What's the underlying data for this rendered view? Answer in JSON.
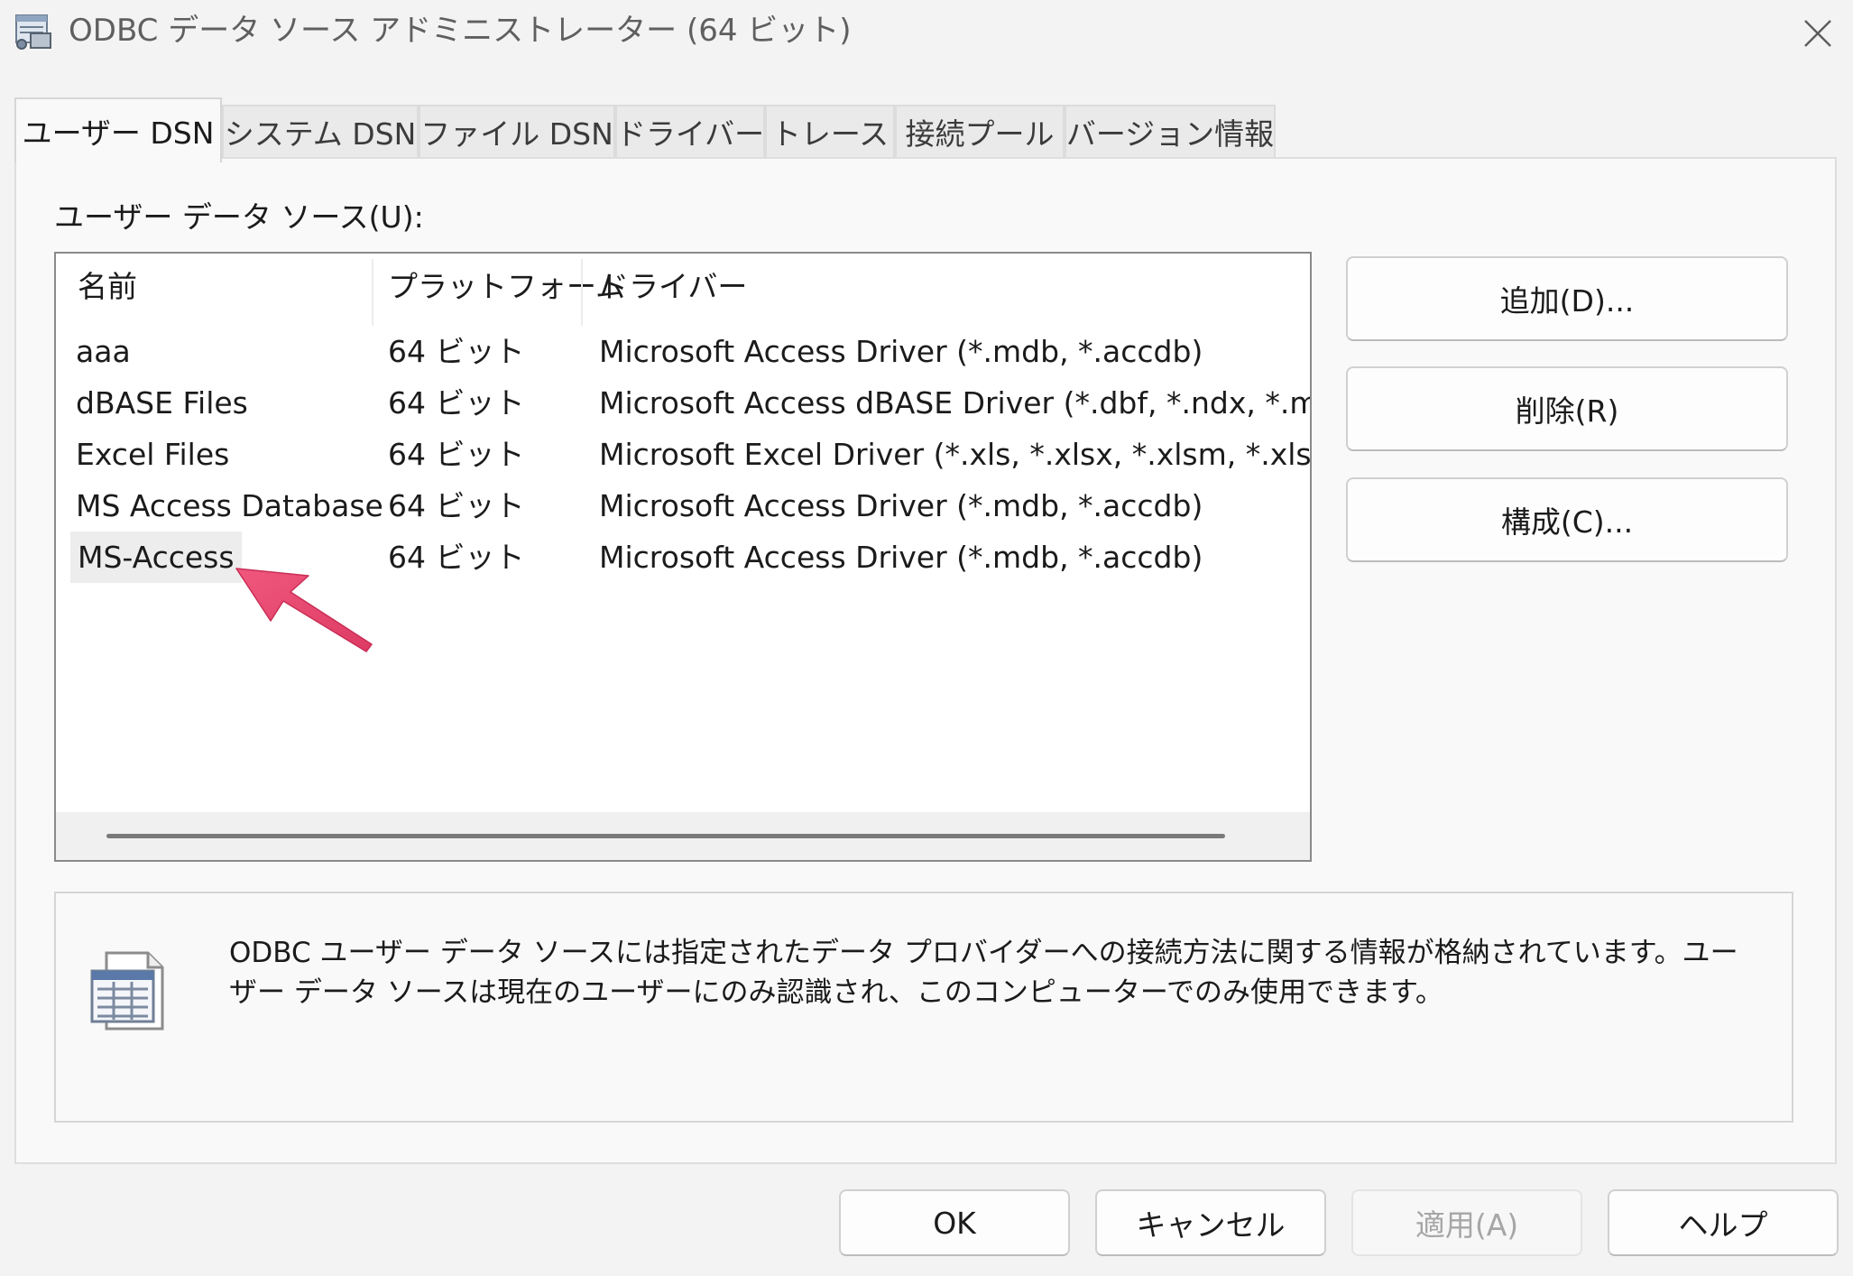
{
  "window": {
    "title": "ODBC データ ソース アドミニストレーター (64 ビット)",
    "icon": "database-admin-icon",
    "close_icon": "close-icon"
  },
  "tabs": [
    {
      "label": "ユーザー DSN",
      "active": true
    },
    {
      "label": "システム DSN",
      "active": false
    },
    {
      "label": "ファイル DSN",
      "active": false
    },
    {
      "label": "ドライバー",
      "active": false
    },
    {
      "label": "トレース",
      "active": false
    },
    {
      "label": "接続プール",
      "active": false
    },
    {
      "label": "バージョン情報",
      "active": false
    }
  ],
  "user_dsn": {
    "section_label": "ユーザー データ ソース(U):",
    "columns": [
      "名前",
      "プラットフォーム",
      "ドライバー"
    ],
    "rows": [
      {
        "name": "aaa",
        "platform": "64 ビット",
        "driver": "Microsoft Access Driver (*.mdb, *.accdb)"
      },
      {
        "name": "dBASE Files",
        "platform": "64 ビット",
        "driver": "Microsoft Access dBASE Driver (*.dbf, *.ndx, *.mdx)"
      },
      {
        "name": "Excel Files",
        "platform": "64 ビット",
        "driver": "Microsoft Excel Driver (*.xls, *.xlsx, *.xlsm, *.xlsb)"
      },
      {
        "name": "MS Access Database",
        "platform": "64 ビット",
        "driver": "Microsoft Access Driver (*.mdb, *.accdb)"
      },
      {
        "name": "MS-Access",
        "platform": "64 ビット",
        "driver": "Microsoft Access Driver (*.mdb, *.accdb)"
      }
    ],
    "selected_row": "MS-Access",
    "buttons": {
      "add": "追加(D)...",
      "remove": "削除(R)",
      "configure": "構成(C)..."
    },
    "info_text": "ODBC ユーザー データ ソースには指定されたデータ プロバイダーへの接続方法に関する情報が格納されています。ユーザー データ ソースは現在のユーザーにのみ認識され、このコンピューターでのみ使用できます。",
    "info_icon": "data-source-document-icon"
  },
  "footer_buttons": {
    "ok": "OK",
    "cancel": "キャンセル",
    "apply": "適用(A)",
    "help": "ヘルプ"
  },
  "annotation": {
    "arrow_icon": "pointer-arrow-icon",
    "color": "#e8466f"
  }
}
